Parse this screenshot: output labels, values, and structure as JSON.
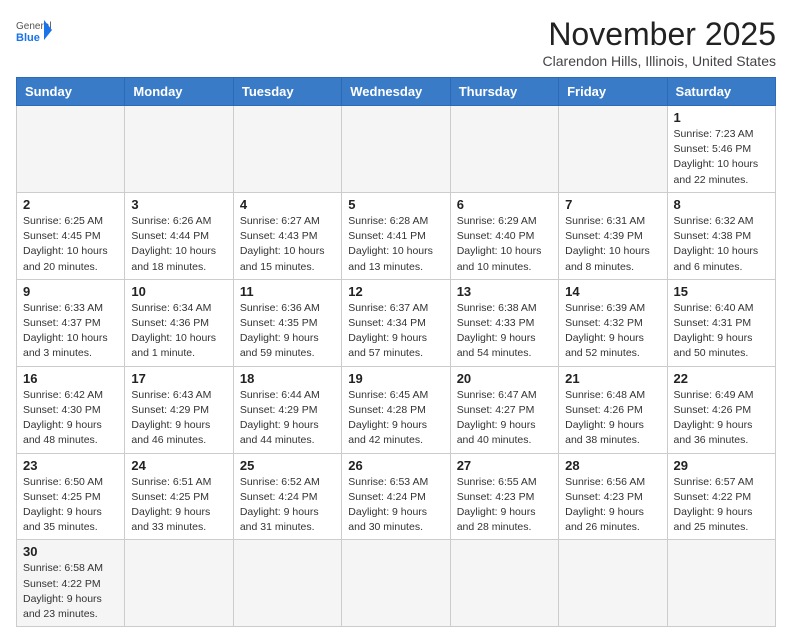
{
  "header": {
    "logo_general": "General",
    "logo_blue": "Blue",
    "month_title": "November 2025",
    "subtitle": "Clarendon Hills, Illinois, United States"
  },
  "weekdays": [
    "Sunday",
    "Monday",
    "Tuesday",
    "Wednesday",
    "Thursday",
    "Friday",
    "Saturday"
  ],
  "weeks": [
    [
      {
        "day": "",
        "info": ""
      },
      {
        "day": "",
        "info": ""
      },
      {
        "day": "",
        "info": ""
      },
      {
        "day": "",
        "info": ""
      },
      {
        "day": "",
        "info": ""
      },
      {
        "day": "",
        "info": ""
      },
      {
        "day": "1",
        "info": "Sunrise: 7:23 AM\nSunset: 5:46 PM\nDaylight: 10 hours and 22 minutes."
      }
    ],
    [
      {
        "day": "2",
        "info": "Sunrise: 6:25 AM\nSunset: 4:45 PM\nDaylight: 10 hours and 20 minutes."
      },
      {
        "day": "3",
        "info": "Sunrise: 6:26 AM\nSunset: 4:44 PM\nDaylight: 10 hours and 18 minutes."
      },
      {
        "day": "4",
        "info": "Sunrise: 6:27 AM\nSunset: 4:43 PM\nDaylight: 10 hours and 15 minutes."
      },
      {
        "day": "5",
        "info": "Sunrise: 6:28 AM\nSunset: 4:41 PM\nDaylight: 10 hours and 13 minutes."
      },
      {
        "day": "6",
        "info": "Sunrise: 6:29 AM\nSunset: 4:40 PM\nDaylight: 10 hours and 10 minutes."
      },
      {
        "day": "7",
        "info": "Sunrise: 6:31 AM\nSunset: 4:39 PM\nDaylight: 10 hours and 8 minutes."
      },
      {
        "day": "8",
        "info": "Sunrise: 6:32 AM\nSunset: 4:38 PM\nDaylight: 10 hours and 6 minutes."
      }
    ],
    [
      {
        "day": "9",
        "info": "Sunrise: 6:33 AM\nSunset: 4:37 PM\nDaylight: 10 hours and 3 minutes."
      },
      {
        "day": "10",
        "info": "Sunrise: 6:34 AM\nSunset: 4:36 PM\nDaylight: 10 hours and 1 minute."
      },
      {
        "day": "11",
        "info": "Sunrise: 6:36 AM\nSunset: 4:35 PM\nDaylight: 9 hours and 59 minutes."
      },
      {
        "day": "12",
        "info": "Sunrise: 6:37 AM\nSunset: 4:34 PM\nDaylight: 9 hours and 57 minutes."
      },
      {
        "day": "13",
        "info": "Sunrise: 6:38 AM\nSunset: 4:33 PM\nDaylight: 9 hours and 54 minutes."
      },
      {
        "day": "14",
        "info": "Sunrise: 6:39 AM\nSunset: 4:32 PM\nDaylight: 9 hours and 52 minutes."
      },
      {
        "day": "15",
        "info": "Sunrise: 6:40 AM\nSunset: 4:31 PM\nDaylight: 9 hours and 50 minutes."
      }
    ],
    [
      {
        "day": "16",
        "info": "Sunrise: 6:42 AM\nSunset: 4:30 PM\nDaylight: 9 hours and 48 minutes."
      },
      {
        "day": "17",
        "info": "Sunrise: 6:43 AM\nSunset: 4:29 PM\nDaylight: 9 hours and 46 minutes."
      },
      {
        "day": "18",
        "info": "Sunrise: 6:44 AM\nSunset: 4:29 PM\nDaylight: 9 hours and 44 minutes."
      },
      {
        "day": "19",
        "info": "Sunrise: 6:45 AM\nSunset: 4:28 PM\nDaylight: 9 hours and 42 minutes."
      },
      {
        "day": "20",
        "info": "Sunrise: 6:47 AM\nSunset: 4:27 PM\nDaylight: 9 hours and 40 minutes."
      },
      {
        "day": "21",
        "info": "Sunrise: 6:48 AM\nSunset: 4:26 PM\nDaylight: 9 hours and 38 minutes."
      },
      {
        "day": "22",
        "info": "Sunrise: 6:49 AM\nSunset: 4:26 PM\nDaylight: 9 hours and 36 minutes."
      }
    ],
    [
      {
        "day": "23",
        "info": "Sunrise: 6:50 AM\nSunset: 4:25 PM\nDaylight: 9 hours and 35 minutes."
      },
      {
        "day": "24",
        "info": "Sunrise: 6:51 AM\nSunset: 4:25 PM\nDaylight: 9 hours and 33 minutes."
      },
      {
        "day": "25",
        "info": "Sunrise: 6:52 AM\nSunset: 4:24 PM\nDaylight: 9 hours and 31 minutes."
      },
      {
        "day": "26",
        "info": "Sunrise: 6:53 AM\nSunset: 4:24 PM\nDaylight: 9 hours and 30 minutes."
      },
      {
        "day": "27",
        "info": "Sunrise: 6:55 AM\nSunset: 4:23 PM\nDaylight: 9 hours and 28 minutes."
      },
      {
        "day": "28",
        "info": "Sunrise: 6:56 AM\nSunset: 4:23 PM\nDaylight: 9 hours and 26 minutes."
      },
      {
        "day": "29",
        "info": "Sunrise: 6:57 AM\nSunset: 4:22 PM\nDaylight: 9 hours and 25 minutes."
      }
    ],
    [
      {
        "day": "30",
        "info": "Sunrise: 6:58 AM\nSunset: 4:22 PM\nDaylight: 9 hours and 23 minutes."
      },
      {
        "day": "",
        "info": ""
      },
      {
        "day": "",
        "info": ""
      },
      {
        "day": "",
        "info": ""
      },
      {
        "day": "",
        "info": ""
      },
      {
        "day": "",
        "info": ""
      },
      {
        "day": "",
        "info": ""
      }
    ]
  ]
}
